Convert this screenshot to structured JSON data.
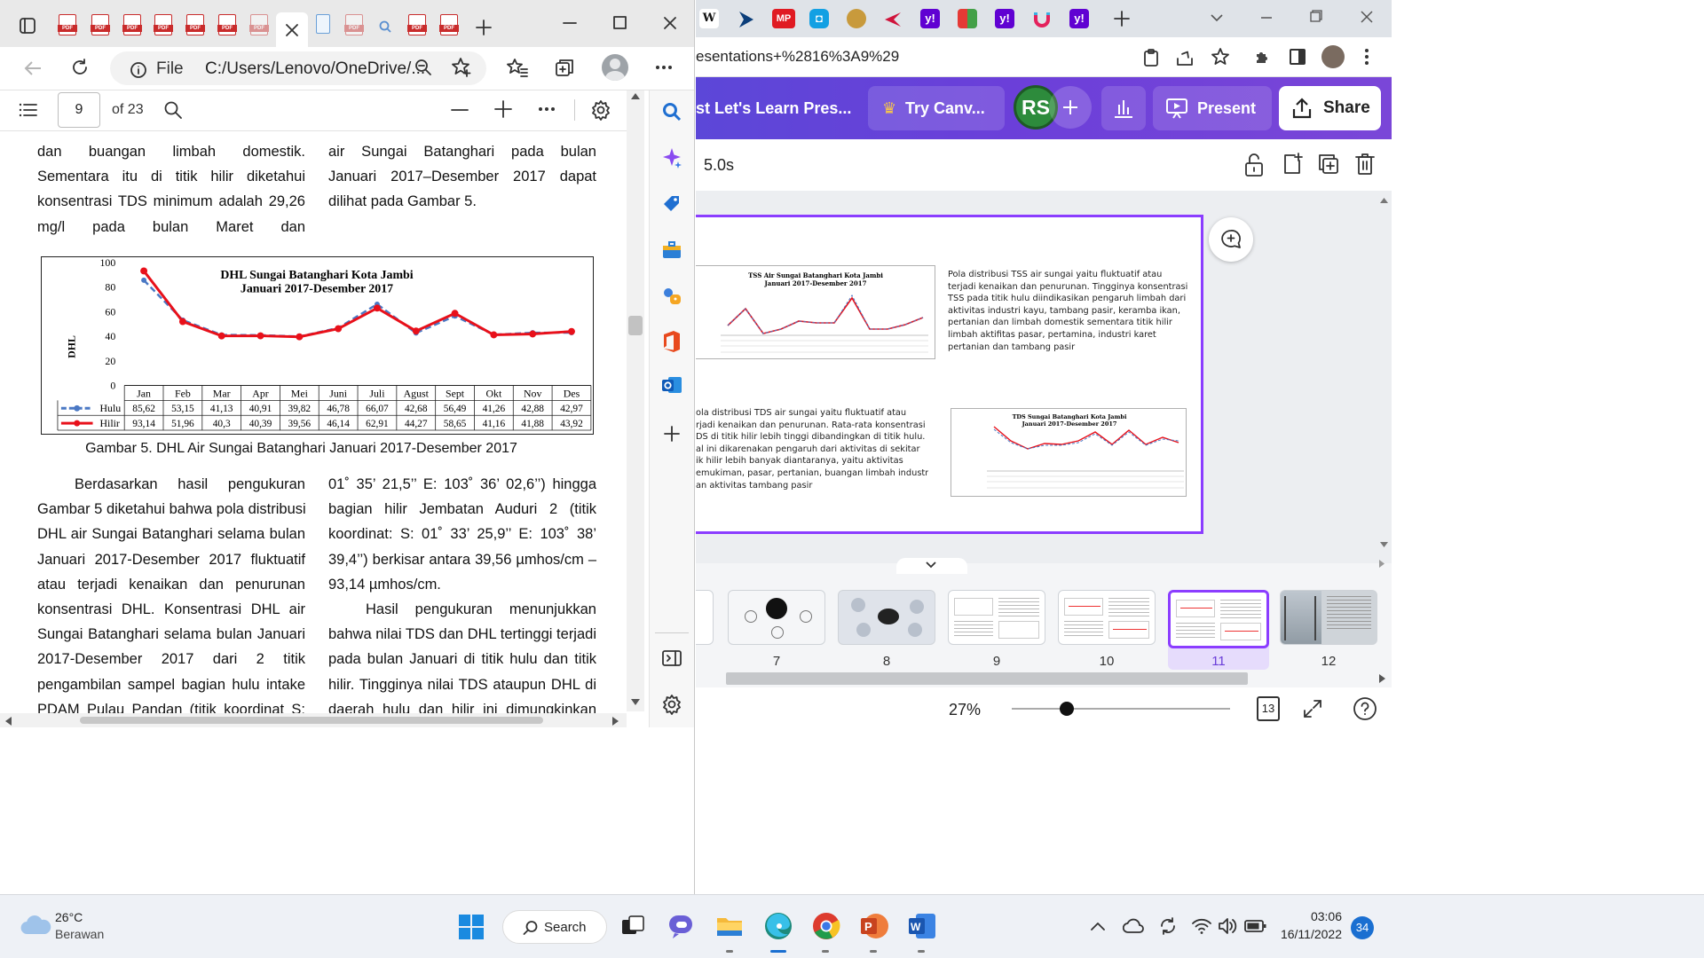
{
  "edge": {
    "tab_count_icons": [
      "pdf",
      "pdf",
      "pdf",
      "pdf",
      "pdf",
      "pdf",
      "pdf-faded",
      "active",
      "doc",
      "pdf-faded",
      "search",
      "pdf",
      "pdf"
    ],
    "address": {
      "prefix": "File",
      "path": "C:/Users/Lenovo/OneDrive/..."
    },
    "pdf_toolbar": {
      "page": "9",
      "of_pages": "of 23"
    },
    "page": {
      "left_col_top": [
        "dan      buangan      limbah      domestik.",
        "Sementara  itu    di  titik  hilir  diketahui",
        "konsentrasi  TDS  minimum  adalah  29,26",
        "mg/l      pada      bulan      Maret      dan"
      ],
      "right_col_top": [
        "air      Sungai  Batanghari  pada  bulan",
        "Januari  2017–Desember  2017  dapat",
        "dilihat pada Gambar 5."
      ],
      "caption": "Gambar 5. DHL Air Sungai Batanghari Januari 2017-Desember 2017",
      "left_col_bottom": [
        "Berdasarkan    hasil    pengukuran",
        "Gambar 5 diketahui bahwa pola distribusi",
        "DHL air Sungai Batanghari selama bulan",
        "Januari  2017-Desember  2017  fluktuatif",
        "atau   terjadi   kenaikan   dan   penurunan",
        "konsentrasi  DHL.  Konsentrasi  DHL  air",
        "Sungai Batanghari selama bulan Januari",
        "2017-Desember      2017      dari      2      titik",
        "pengambilan sampel bagian hulu intake",
        "PDAM  Pulau  Pandan  (titik  koordinat  S:"
      ],
      "right_col_bottom": [
        "01˚ 35’ 21,5’’ E: 103˚ 36’ 02,6’’) hingga",
        "bagian  hilir  Jembatan  Auduri  2  (titik",
        "koordinat:  S:  01˚  33’  25,9’’  E:  103˚  38’",
        "39,4’’) berkisar antara 39,56 µmhos/cm –",
        "93,14 µmhos/cm.",
        "Hasil    pengukuran    menunjukkan",
        "bahwa nilai TDS dan DHL tertinggi terjadi",
        "pada bulan Januari di titik hulu dan titik",
        "hilir. Tingginya nilai TDS ataupun DHL di",
        "daerah  hulu  dan  hilir  ini  dimungkinkan"
      ]
    }
  },
  "chart_data": [
    {
      "type": "line",
      "title": "DHL Sungai Batanghari Kota Jambi",
      "subtitle": "Januari 2017-Desember 2017",
      "ylabel": "DHL",
      "ylim": [
        0,
        100
      ],
      "yticks": [
        0,
        20,
        40,
        60,
        80,
        100
      ],
      "categories": [
        "Jan",
        "Feb",
        "Mar",
        "Apr",
        "Mei",
        "Juni",
        "Juli",
        "Agust",
        "Sept",
        "Okt",
        "Nov",
        "Des"
      ],
      "series": [
        {
          "name": "Hulu",
          "color": "#4a78c4",
          "dashed": true,
          "values": [
            85.62,
            53.15,
            41.13,
            40.91,
            39.82,
            46.78,
            66.07,
            42.68,
            56.49,
            41.26,
            42.88,
            42.97
          ],
          "labels": [
            "85,62",
            "53,15",
            "41,13",
            "40,91",
            "39,82",
            "46,78",
            "66,07",
            "42,68",
            "56,49",
            "41,26",
            "42,88",
            "42,97"
          ]
        },
        {
          "name": "Hilir",
          "color": "#e8101a",
          "dashed": false,
          "values": [
            93.14,
            51.96,
            40.3,
            40.39,
            39.56,
            46.14,
            62.91,
            44.27,
            58.65,
            41.16,
            41.88,
            43.92
          ],
          "labels": [
            "93,14",
            "51,96",
            "40,3",
            "40,39",
            "39,56",
            "46,14",
            "62,91",
            "44,27",
            "58,65",
            "41,16",
            "41,88",
            "43,92"
          ]
        }
      ],
      "grid": false,
      "legend": "table-bottom"
    }
  ],
  "chrome": {
    "url": "esentations+%2816%3A9%29",
    "canva": {
      "title": "st Let's Learn Pres...",
      "try": "Try Canv...",
      "avatar": "RS",
      "present": "Present",
      "share": "Share",
      "duration": "5.0s"
    },
    "slide": {
      "chart_tss_title": "TSS Air Sungai Batanghari Kota Jambi",
      "chart_tss_sub": "Januari 2017-Desember 2017",
      "chart_tds_title": "TDS Sungai Batanghari Kota Jambi",
      "chart_tds_sub": "Januari 2017-Desember 2017",
      "text_tss": [
        "Pola  distribusi  TSS  air  sungai  yaitu  fluktuatif   atau",
        "terjadi kenaikan dan penurunan. Tingginya konsentrasi",
        "TSS pada titik hulu diindikasikan pengaruh limbah dari",
        "aktivitas  industri  kayu,  tambang  pasir,  keramba  ikan,",
        "pertanian  dan  limbah  domestik  sementara  titik  hilir",
        "limbah   aktifitas   pasar,   pertamina,   industri   karet",
        "pertanian dan tambang pasir"
      ],
      "text_tds": [
        "ola  distribusi  TDS  air  sungai  yaitu  fluktuatif  atau",
        "rjadi kenaikan dan penurunan. Rata-rata konsentrasi",
        "DS di titik hilir lebih tinggi dibandingkan di titik hulu.",
        "al  ini  dikarenakan  pengaruh  dari  aktivitas  di  sekitar",
        "ik  hilir  lebih  banyak  diantaranya,  yaitu  aktivitas",
        "emukiman, pasar, pertanian, buangan limbah industri,",
        "an aktivitas tambang pasir"
      ]
    },
    "thumbnails": [
      "7",
      "8",
      "9",
      "10",
      "11",
      "12"
    ],
    "zoom": "27%",
    "pages_badge": "13"
  },
  "taskbar": {
    "weather_temp": "26°C",
    "weather_desc": "Berawan",
    "search": "Search",
    "time": "03:06",
    "date": "16/11/2022",
    "notif": "34"
  }
}
